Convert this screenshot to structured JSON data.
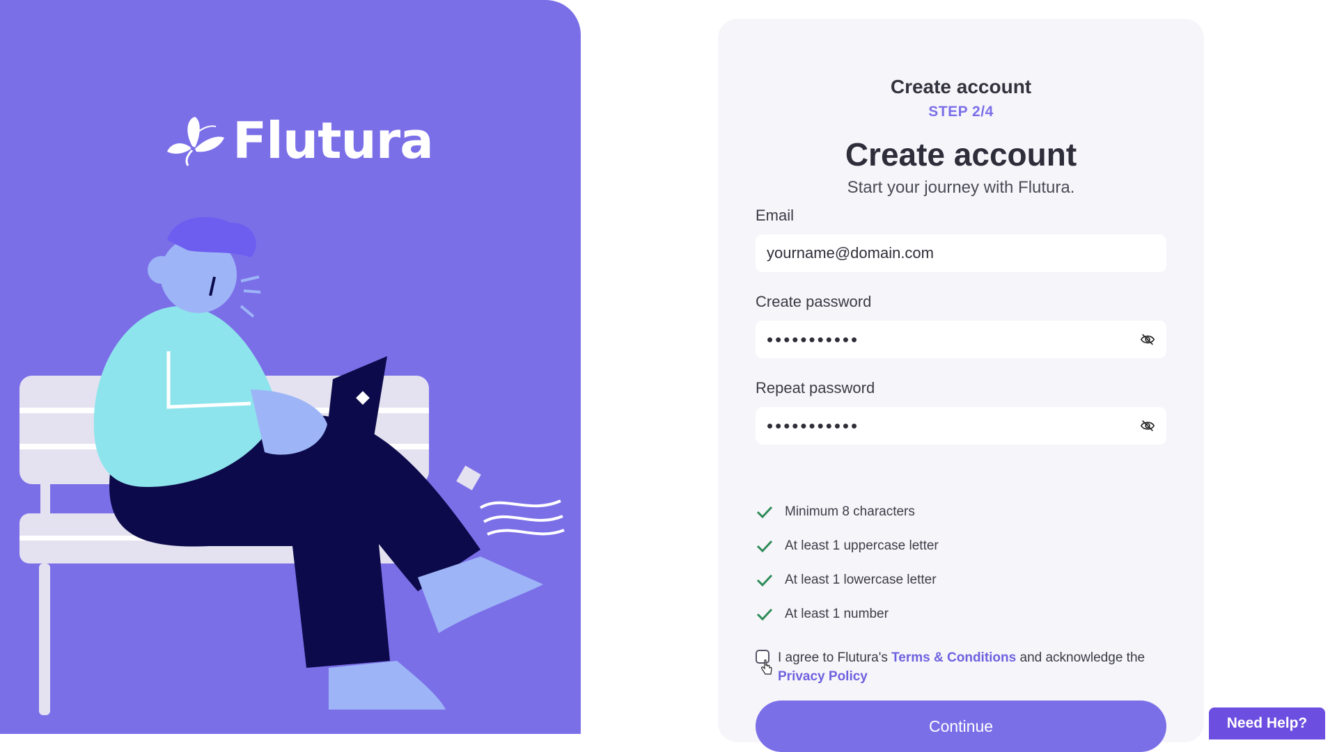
{
  "brand": {
    "name": "Flutura",
    "logo_icon": "butterfly-icon"
  },
  "card": {
    "header_title": "Create account",
    "step": "STEP 2/4",
    "title": "Create account",
    "subtitle": "Start your journey with Flutura."
  },
  "form": {
    "email": {
      "label": "Email",
      "value": "yourname@domain.com"
    },
    "password": {
      "label": "Create password",
      "value": "•••••••••••",
      "toggle_icon": "eye-off-icon"
    },
    "repeat_password": {
      "label": "Repeat password",
      "value": "•••••••••••",
      "toggle_icon": "eye-off-icon"
    }
  },
  "requirements": [
    {
      "text": "Minimum 8 characters",
      "met": true
    },
    {
      "text": "At least 1 uppercase letter",
      "met": true
    },
    {
      "text": "At least 1 lowercase letter",
      "met": true
    },
    {
      "text": "At least 1 number",
      "met": true
    }
  ],
  "agreement": {
    "checked": false,
    "prefix": "I agree to Flutura's ",
    "terms_link": "Terms & Conditions",
    "middle": " and acknowledge the ",
    "privacy_link": "Privacy Policy"
  },
  "buttons": {
    "continue": "Continue",
    "help": "Need Help?"
  },
  "colors": {
    "accent": "#7b6fe8",
    "check": "#2e8b57",
    "help_button": "#6c4fe0",
    "card_bg": "#f6f5fa"
  }
}
